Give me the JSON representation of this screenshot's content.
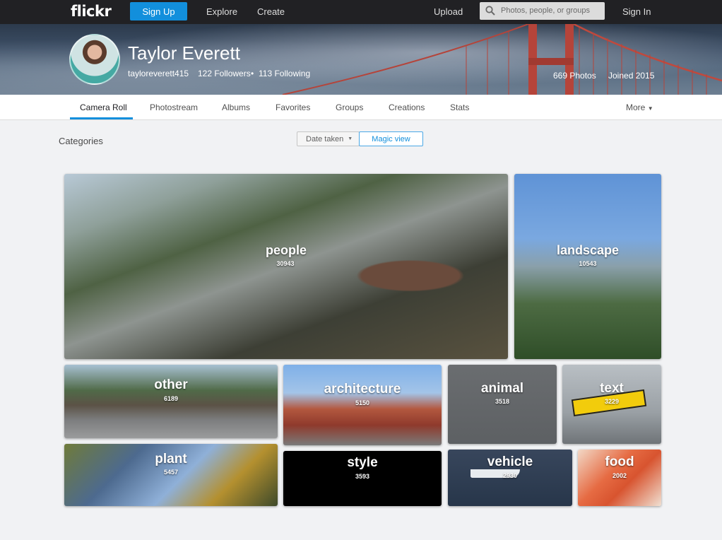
{
  "topnav": {
    "logo": "flickr",
    "signup_label": "Sign Up",
    "explore_label": "Explore",
    "create_label": "Create",
    "upload_label": "Upload",
    "search_placeholder": "Photos, people, or groups",
    "signin_label": "Sign In"
  },
  "profile": {
    "name": "Taylor Everett",
    "username": "tayloreverett415",
    "followers": "122 Followers",
    "separator": "•",
    "following": "113 Following",
    "photos": "669 Photos",
    "joined": "Joined 2015"
  },
  "tabs": [
    "Camera Roll",
    "Photostream",
    "Albums",
    "Favorites",
    "Groups",
    "Creations",
    "Stats"
  ],
  "more_label": "More",
  "categories_label": "Categories",
  "view_buttons": {
    "date_taken": "Date taken",
    "magic_view": "Magic view"
  },
  "tiles": [
    {
      "label": "people",
      "count": "30943"
    },
    {
      "label": "landscape",
      "count": "10543"
    },
    {
      "label": "other",
      "count": "6189"
    },
    {
      "label": "architecture",
      "count": "5150"
    },
    {
      "label": "animal",
      "count": "3518"
    },
    {
      "label": "text",
      "count": "3229"
    },
    {
      "label": "plant",
      "count": "5457"
    },
    {
      "label": "style",
      "count": "3593"
    },
    {
      "label": "vehicle",
      "count": "2930"
    },
    {
      "label": "food",
      "count": "2002"
    }
  ],
  "colors": {
    "accent": "#128fdc",
    "topnav": "#212124",
    "page_bg": "#f1f2f4"
  }
}
